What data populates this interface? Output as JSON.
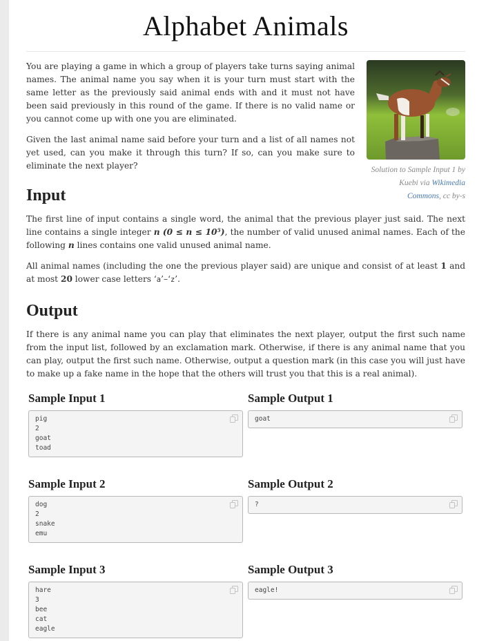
{
  "title": "Alphabet Animals",
  "intro": {
    "paragraphs": [
      "You are playing a game in which a group of players take turns saying animal names. The animal name you say when it is your turn must start with the same letter as the previously said animal ends with and it must not have been said previously in this round of the game. If there is no valid name or you cannot come up with one you are eliminated.",
      "Given the last animal name said before your turn and a list of all names not yet used, can you make it through this turn? If so, can you make sure to eliminate the next player?"
    ]
  },
  "figure": {
    "image_alt": "goat-standing-on-tree-stump",
    "caption_prefix": "Solution to Sample Input 1 by Kuebi via ",
    "caption_link": "Wikimedia Commons",
    "caption_suffix": ", cc by-s"
  },
  "input_section": {
    "heading": "Input",
    "p1_a": "The first line of input contains a single word, the animal that the previous player just said. The next line contains a single integer ",
    "p1_var": "n",
    "p1_math": "(0 ≤ n ≤ 10⁵)",
    "p1_b": ", the number of valid unused animal names. Each of the following ",
    "p1_c": " lines contains one valid unused animal name.",
    "p2_a": "All animal names (including the one the previous player said) are unique and consist of at least ",
    "p2_min": "1",
    "p2_b": " and at most ",
    "p2_max": "20",
    "p2_c": " lower case letters ‘",
    "p2_from": "a",
    "p2_d": "’–‘",
    "p2_to": "z",
    "p2_e": "’."
  },
  "output_section": {
    "heading": "Output",
    "text": "If there is any animal name you can play that eliminates the next player, output the first such name from the input list, followed by an exclamation mark. Otherwise, if there is any animal name that you can play, output the first such name. Otherwise, output a question mark (in this case you will just have to make up a fake name in the hope that the others will trust you that this is a real animal)."
  },
  "samples": [
    {
      "input_label": "Sample Input 1",
      "input": "pig\n2\ngoat\ntoad",
      "output_label": "Sample Output 1",
      "output": "goat"
    },
    {
      "input_label": "Sample Input 2",
      "input": "dog\n2\nsnake\nemu",
      "output_label": "Sample Output 2",
      "output": "?"
    },
    {
      "input_label": "Sample Input 3",
      "input": "hare\n3\nbee\ncat\neagle",
      "output_label": "Sample Output 3",
      "output": "eagle!"
    }
  ],
  "colors": {
    "link": "#4a7ab5",
    "caption": "#888888",
    "sample_bg": "#f4f4f4",
    "sample_border": "#b8b8b8"
  }
}
